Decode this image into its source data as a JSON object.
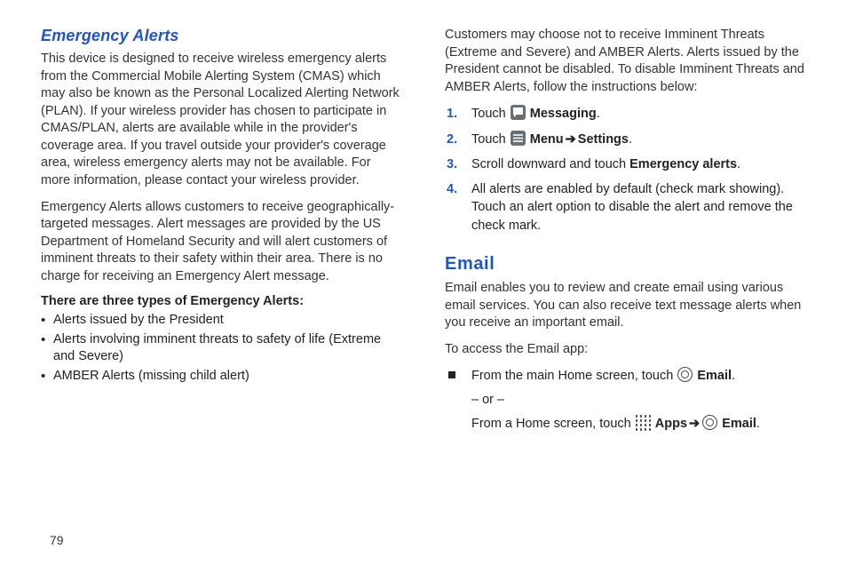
{
  "left": {
    "heading": "Emergency Alerts",
    "p1": "This device is designed to receive wireless emergency alerts from the Commercial Mobile Alerting System (CMAS) which may also be known as the Personal Localized Alerting Network (PLAN). If your wireless provider has chosen to participate in CMAS/PLAN, alerts are available while in the provider's coverage area. If you travel outside your provider's coverage area, wireless emergency alerts may not be available. For more information, please contact your wireless provider.",
    "p2": "Emergency Alerts allows customers to receive geographically-targeted messages. Alert messages are provided by the US Department of Homeland Security and will alert customers of imminent threats to their safety within their area. There is no charge for receiving an Emergency Alert message.",
    "types_heading": "There are three types of Emergency Alerts:",
    "bullets": [
      "Alerts issued by the President",
      "Alerts involving imminent threats to safety of life (Extreme and Severe)",
      "AMBER Alerts (missing child alert)"
    ]
  },
  "right": {
    "p1": "Customers may choose not to receive Imminent Threats (Extreme and Severe) and AMBER Alerts. Alerts issued by the President cannot be disabled. To disable Imminent Threats and AMBER Alerts, follow the instructions below:",
    "steps": {
      "s1_a": "Touch ",
      "s1_b": "Messaging",
      "s1_c": ".",
      "s2_a": "Touch ",
      "s2_b": "Menu",
      "s2_c": "Settings",
      "s2_d": ".",
      "s3_a": "Scroll downward and touch ",
      "s3_b": "Emergency alerts",
      "s3_c": ".",
      "s4": "All alerts are enabled by default (check mark showing). Touch an alert option to disable the alert and remove the check mark."
    },
    "email_heading": "Email",
    "email_p1": "Email enables you to review and create email using various email services. You can also receive text message alerts when you receive an important email.",
    "email_p2": "To access the Email app:",
    "email_li_a": "From the main Home screen, touch ",
    "email_li_b": "Email",
    "email_li_c": ".",
    "email_or": "– or –",
    "email_li2_a": "From a Home screen, touch ",
    "email_li2_b": "Apps",
    "email_li2_c": "Email",
    "email_li2_d": "."
  },
  "arrow": "➔",
  "page_number": "79"
}
